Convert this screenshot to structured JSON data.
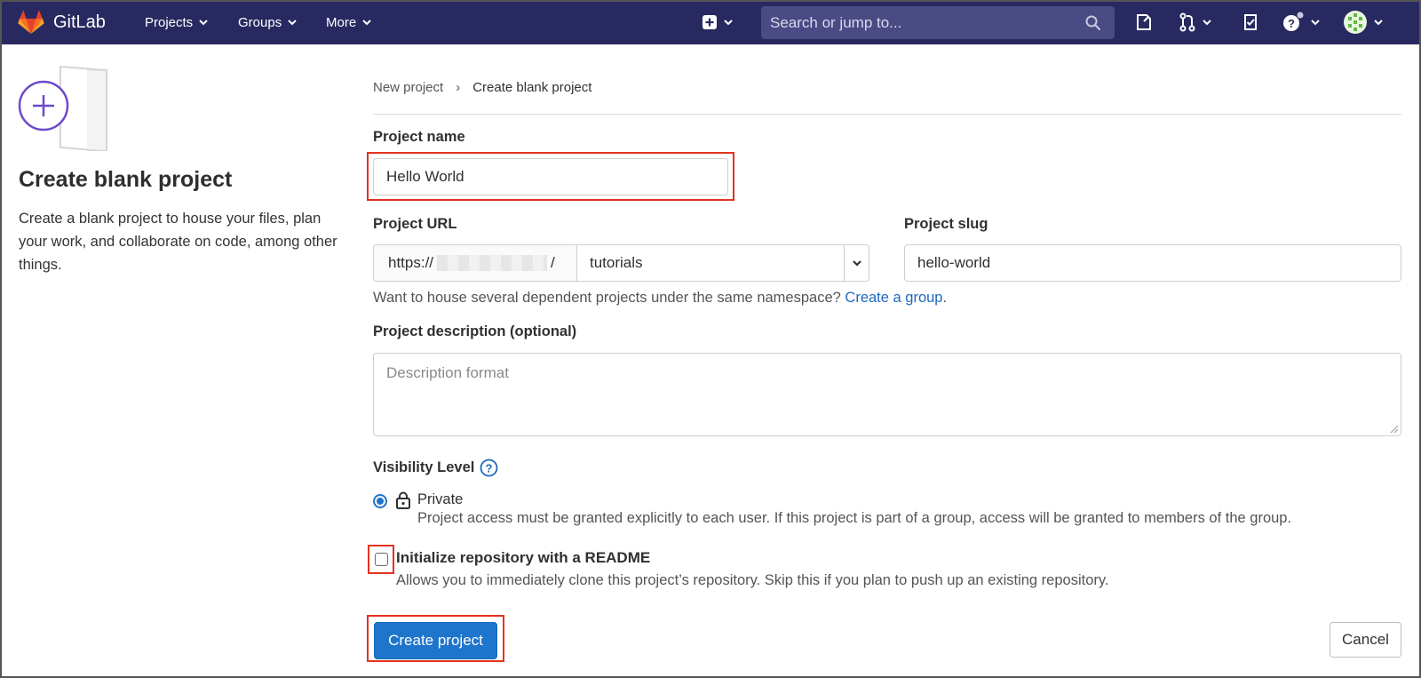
{
  "navbar": {
    "brand": "GitLab",
    "menus": [
      {
        "label": "Projects"
      },
      {
        "label": "Groups"
      },
      {
        "label": "More"
      }
    ],
    "search_placeholder": "Search or jump to..."
  },
  "sidebar": {
    "title": "Create blank project",
    "description": "Create a blank project to house your files, plan your work, and collaborate on code, among other things."
  },
  "breadcrumb": {
    "parent": "New project",
    "separator": "›",
    "current": "Create blank project"
  },
  "form": {
    "project_name": {
      "label": "Project name",
      "value": "Hello World"
    },
    "project_url": {
      "label": "Project URL",
      "prefix": "https://",
      "suffix": "/",
      "namespace": "tutorials"
    },
    "project_slug": {
      "label": "Project slug",
      "value": "hello-world"
    },
    "namespace_help": {
      "text": "Want to house several dependent projects under the same namespace?",
      "link": "Create a group",
      "trail": "."
    },
    "description": {
      "label": "Project description (optional)",
      "placeholder": "Description format"
    },
    "visibility": {
      "label": "Visibility Level",
      "selected": "Private",
      "option_label": "Private",
      "option_desc": "Project access must be granted explicitly to each user. If this project is part of a group, access will be granted to members of the group."
    },
    "readme": {
      "label": "Initialize repository with a README",
      "desc": "Allows you to immediately clone this project’s repository. Skip this if you plan to push up an existing repository.",
      "checked": false
    },
    "create_button": "Create project",
    "cancel_button": "Cancel"
  },
  "colors": {
    "navbar": "#292961",
    "primary": "#1f75cb",
    "link": "#1f69c0",
    "highlight": "#e3331f"
  }
}
